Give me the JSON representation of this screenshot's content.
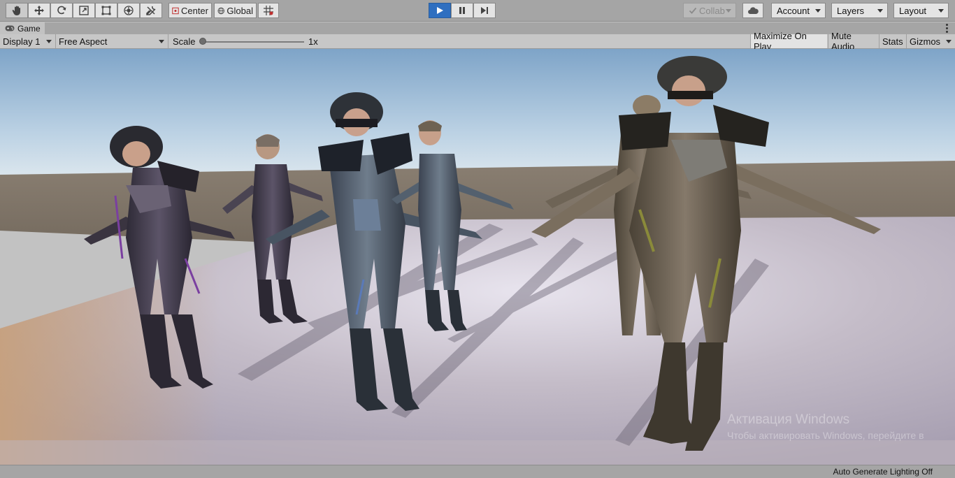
{
  "toolbar": {
    "tools": [
      {
        "name": "hand-tool",
        "icon": "hand-icon"
      },
      {
        "name": "move-tool",
        "icon": "move-icon"
      },
      {
        "name": "rotate-tool",
        "icon": "rotate-icon"
      },
      {
        "name": "scale-tool",
        "icon": "scale-icon"
      },
      {
        "name": "rect-tool",
        "icon": "rect-icon"
      },
      {
        "name": "transform-tool",
        "icon": "transform-icon"
      },
      {
        "name": "custom-tool",
        "icon": "wrench-icon"
      }
    ],
    "pivot_label": "Center",
    "rotation_label": "Global",
    "snap_icon": "grid-snap-icon",
    "playback": {
      "play": "play-icon",
      "pause": "pause-icon",
      "step": "step-icon",
      "play_color": "#2f6fc0"
    },
    "collab_label": "Collab",
    "cloud_icon": "cloud-icon",
    "account_label": "Account",
    "layers_label": "Layers",
    "layout_label": "Layout"
  },
  "tab": {
    "title": "Game",
    "icon": "gamepad-icon"
  },
  "gamebar": {
    "display": "Display 1",
    "aspect": "Free Aspect",
    "scale_label": "Scale",
    "scale_value": "1x",
    "maximize": "Maximize On Play",
    "mute": "Mute Audio",
    "stats": "Stats",
    "gizmos": "Gizmos"
  },
  "watermark": {
    "line1": "Активация Windows",
    "line2": "Чтобы активировать Windows, перейдите в"
  },
  "status": {
    "text": "Auto Generate Lighting Off"
  }
}
